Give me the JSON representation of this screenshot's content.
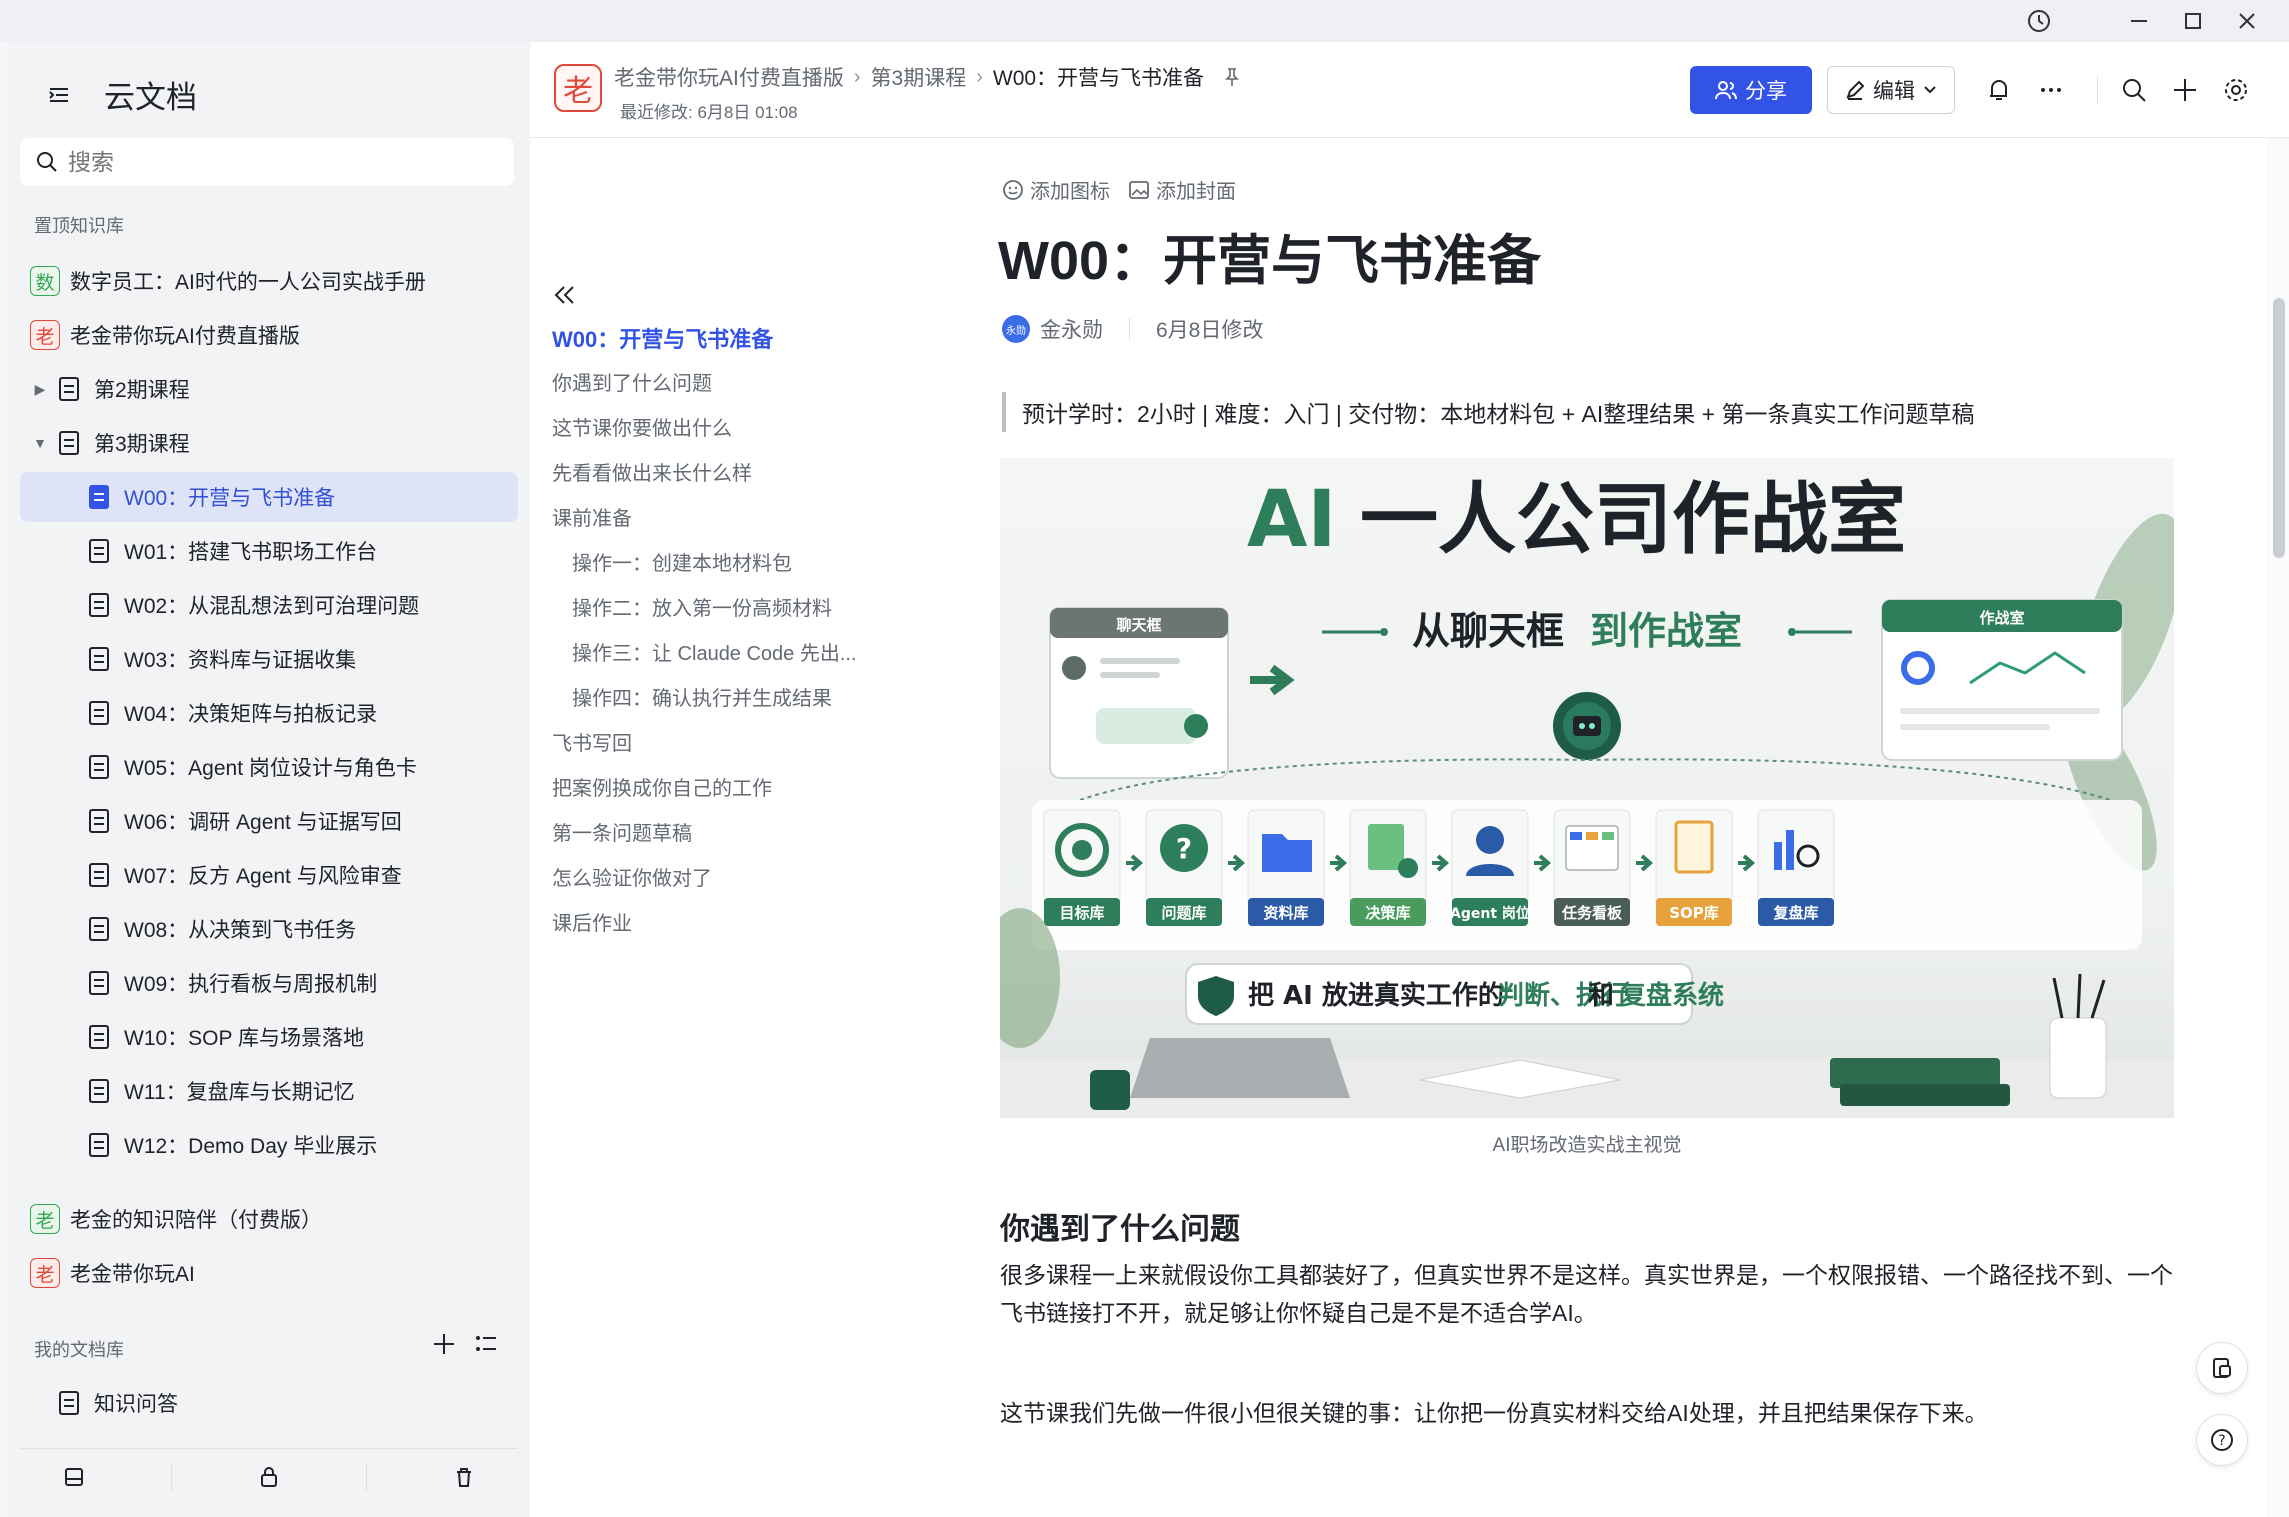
{
  "app": {
    "title": "云文档"
  },
  "sidebar": {
    "search_placeholder": "搜索",
    "pinned_label": "置顶知识库",
    "my_label": "我的文档库",
    "pinned": [
      {
        "badge": "数",
        "label": "数字员工：AI时代的一人公司实战手册"
      },
      {
        "badge": "老",
        "label": "老金带你玩AI付费直播版"
      }
    ],
    "tree": [
      {
        "label": "第2期课程"
      },
      {
        "label": "第3期课程"
      },
      {
        "label": "W00：开营与飞书准备"
      },
      {
        "label": "W01：搭建飞书职场工作台"
      },
      {
        "label": "W02：从混乱想法到可治理问题"
      },
      {
        "label": "W03：资料库与证据收集"
      },
      {
        "label": "W04：决策矩阵与拍板记录"
      },
      {
        "label": "W05：Agent 岗位设计与角色卡"
      },
      {
        "label": "W06：调研 Agent 与证据写回"
      },
      {
        "label": "W07：反方 Agent 与风险审查"
      },
      {
        "label": "W08：从决策到飞书任务"
      },
      {
        "label": "W09：执行看板与周报机制"
      },
      {
        "label": "W10：SOP 库与场景落地"
      },
      {
        "label": "W11：复盘库与长期记忆"
      },
      {
        "label": "W12：Demo Day 毕业展示"
      }
    ],
    "more_kbs": [
      {
        "badge": "老",
        "label": "老金的知识陪伴（付费版）"
      },
      {
        "badge": "老",
        "label": "老金带你玩AI"
      }
    ],
    "my_docs": [
      {
        "label": "知识问答"
      }
    ]
  },
  "header": {
    "logo": "老",
    "breadcrumb": [
      "老金带你玩AI付费直播版",
      "第3期课程",
      "W00：开营与飞书准备"
    ],
    "last_modified": "最近修改: 6月8日 01:08",
    "share_label": "分享",
    "edit_label": "编辑"
  },
  "toc": {
    "items": [
      {
        "label": "W00：开营与飞书准备",
        "level": 1
      },
      {
        "label": "你遇到了什么问题",
        "level": 1
      },
      {
        "label": "这节课你要做出什么",
        "level": 1
      },
      {
        "label": "先看看做出来长什么样",
        "level": 1
      },
      {
        "label": "课前准备",
        "level": 1
      },
      {
        "label": "操作一：创建本地材料包",
        "level": 2
      },
      {
        "label": "操作二：放入第一份高频材料",
        "level": 2
      },
      {
        "label": "操作三：让 Claude Code 先出...",
        "level": 2
      },
      {
        "label": "操作四：确认执行并生成结果",
        "level": 2
      },
      {
        "label": "飞书写回",
        "level": 1
      },
      {
        "label": "把案例换成你自己的工作",
        "level": 1
      },
      {
        "label": "第一条问题草稿",
        "level": 1
      },
      {
        "label": "怎么验证你做对了",
        "level": 1
      },
      {
        "label": "课后作业",
        "level": 1
      }
    ]
  },
  "doc": {
    "add_icon": "添加图标",
    "add_cover": "添加封面",
    "title": "W00：开营与飞书准备",
    "avatar_text": "永勋",
    "author": "金永勋",
    "modified": "6月8日修改",
    "quote": "预计学时：2小时 | 难度：入门 | 交付物：本地材料包 + AI整理结果 + 第一条真实工作问题草稿",
    "hero": {
      "title_ai": "AI",
      "title_rest": "一人公司作战室",
      "subtitle_a": "从聊天框",
      "subtitle_b": "到作战室",
      "chat_label": "聊天框",
      "room_label": "作战室",
      "modules": [
        "目标库",
        "问题库",
        "资料库",
        "决策库",
        "Agent 岗位",
        "任务看板",
        "SOP库",
        "复盘库"
      ],
      "banner_a": "把 AI 放进真实工作的",
      "banner_b": "判断、执行",
      "banner_c": "和",
      "banner_d": "复盘系统"
    },
    "caption": "AI职场改造实战主视觉",
    "h2": "你遇到了什么问题",
    "p1": "很多课程一上来就假设你工具都装好了，但真实世界不是这样。真实世界是，一个权限报错、一个路径找不到、一个飞书链接打不开，就足够让你怀疑自己是不是不适合学AI。",
    "p2": "这节课我们先做一件很小但很关键的事：让你把一份真实材料交给AI处理，并且把结果保存下来。"
  },
  "colors": {
    "accent": "#3253e6",
    "active_bg": "#dfe3f7",
    "hero_green": "#2e7d5b"
  }
}
